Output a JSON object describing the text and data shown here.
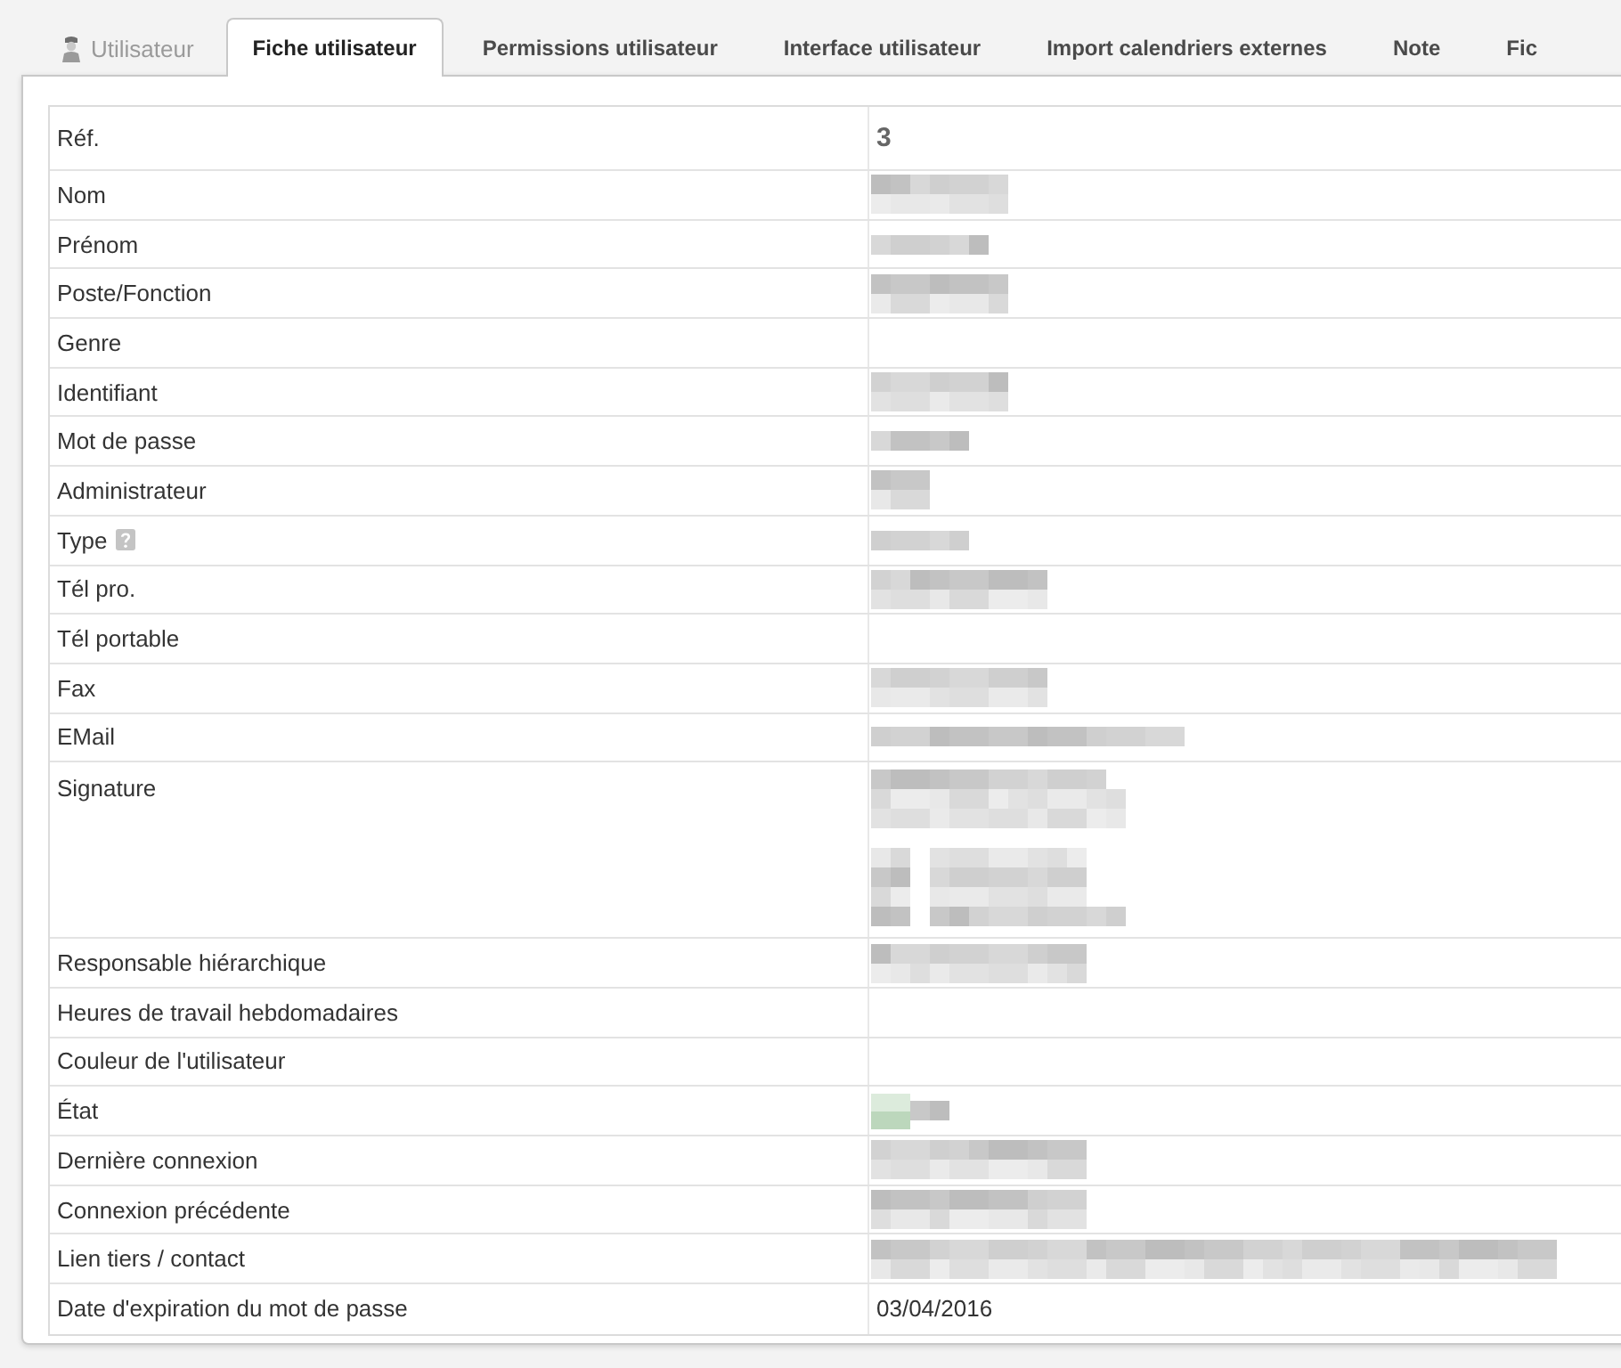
{
  "tabs": [
    {
      "label": "Utilisateur",
      "kind": "head",
      "selected": false
    },
    {
      "label": "Fiche utilisateur",
      "kind": "tab",
      "selected": true
    },
    {
      "label": "Permissions utilisateur",
      "kind": "tab",
      "selected": false
    },
    {
      "label": "Interface utilisateur",
      "kind": "tab",
      "selected": false
    },
    {
      "label": "Import calendriers externes",
      "kind": "tab",
      "selected": false
    },
    {
      "label": "Note",
      "kind": "tab",
      "selected": false
    },
    {
      "label": "Fic",
      "kind": "tab",
      "selected": false
    }
  ],
  "fields": [
    {
      "label": "Réf.",
      "kind": "ref",
      "value": "3"
    },
    {
      "label": "Nom",
      "kind": "medium"
    },
    {
      "label": "Prénom",
      "kind": "short"
    },
    {
      "label": "Poste/Fonction",
      "kind": "medium"
    },
    {
      "label": "Genre",
      "kind": "empty"
    },
    {
      "label": "Identifiant",
      "kind": "medium"
    },
    {
      "label": "Mot de passe",
      "kind": "small"
    },
    {
      "label": "Administrateur",
      "kind": "tiny"
    },
    {
      "label": "Type",
      "kind": "small",
      "help": true
    },
    {
      "label": "Tél pro.",
      "kind": "long"
    },
    {
      "label": "Tél portable",
      "kind": "empty"
    },
    {
      "label": "Fax",
      "kind": "long"
    },
    {
      "label": "EMail",
      "kind": "wide"
    },
    {
      "label": "Signature",
      "kind": "block"
    },
    {
      "label": "Responsable hiérarchique",
      "kind": "longer"
    },
    {
      "label": "Heures de travail hebdomadaires",
      "kind": "empty"
    },
    {
      "label": "Couleur de l'utilisateur",
      "kind": "empty"
    },
    {
      "label": "État",
      "kind": "status"
    },
    {
      "label": "Dernière connexion",
      "kind": "longer"
    },
    {
      "label": "Connexion précédente",
      "kind": "longer"
    },
    {
      "label": "Lien tiers / contact",
      "kind": "full"
    },
    {
      "label": "Date d'expiration du mot de passe",
      "kind": "text",
      "value": "03/04/2016"
    }
  ]
}
